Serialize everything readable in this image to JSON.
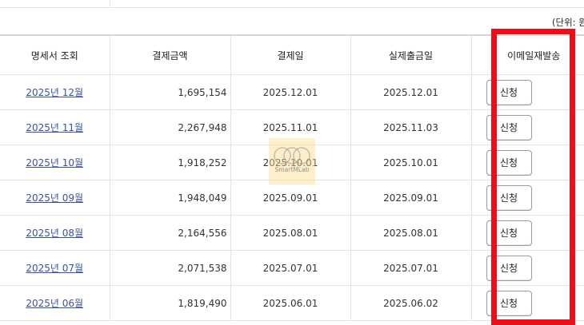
{
  "unit_label": "(단위: 원",
  "columns": [
    "명세서 조회",
    "결제금액",
    "결제일",
    "실제출금일",
    "이메일재발송"
  ],
  "rows": [
    {
      "month": "2025년 12월",
      "amount": "1,695,154",
      "pay_date": "2025.12.01",
      "withdraw_date": "2025.12.01",
      "action": "신청"
    },
    {
      "month": "2025년 11월",
      "amount": "2,267,948",
      "pay_date": "2025.11.01",
      "withdraw_date": "2025.11.03",
      "action": "신청"
    },
    {
      "month": "2025년 10월",
      "amount": "1,918,252",
      "pay_date": "2025.10.01",
      "withdraw_date": "2025.10.01",
      "action": "신청"
    },
    {
      "month": "2025년 09월",
      "amount": "1,948,049",
      "pay_date": "2025.09.01",
      "withdraw_date": "2025.09.01",
      "action": "신청"
    },
    {
      "month": "2025년 08월",
      "amount": "2,164,556",
      "pay_date": "2025.08.01",
      "withdraw_date": "2025.08.01",
      "action": "신청"
    },
    {
      "month": "2025년 07월",
      "amount": "2,071,538",
      "pay_date": "2025.07.01",
      "withdraw_date": "2025.07.01",
      "action": "신청"
    },
    {
      "month": "2025년 06월",
      "amount": "1,819,490",
      "pay_date": "2025.06.01",
      "withdraw_date": "2025.06.02",
      "action": "신청"
    }
  ],
  "watermark": "SmartMLab",
  "colors": {
    "highlight": "#e8101b",
    "link": "#3b4fa1"
  }
}
